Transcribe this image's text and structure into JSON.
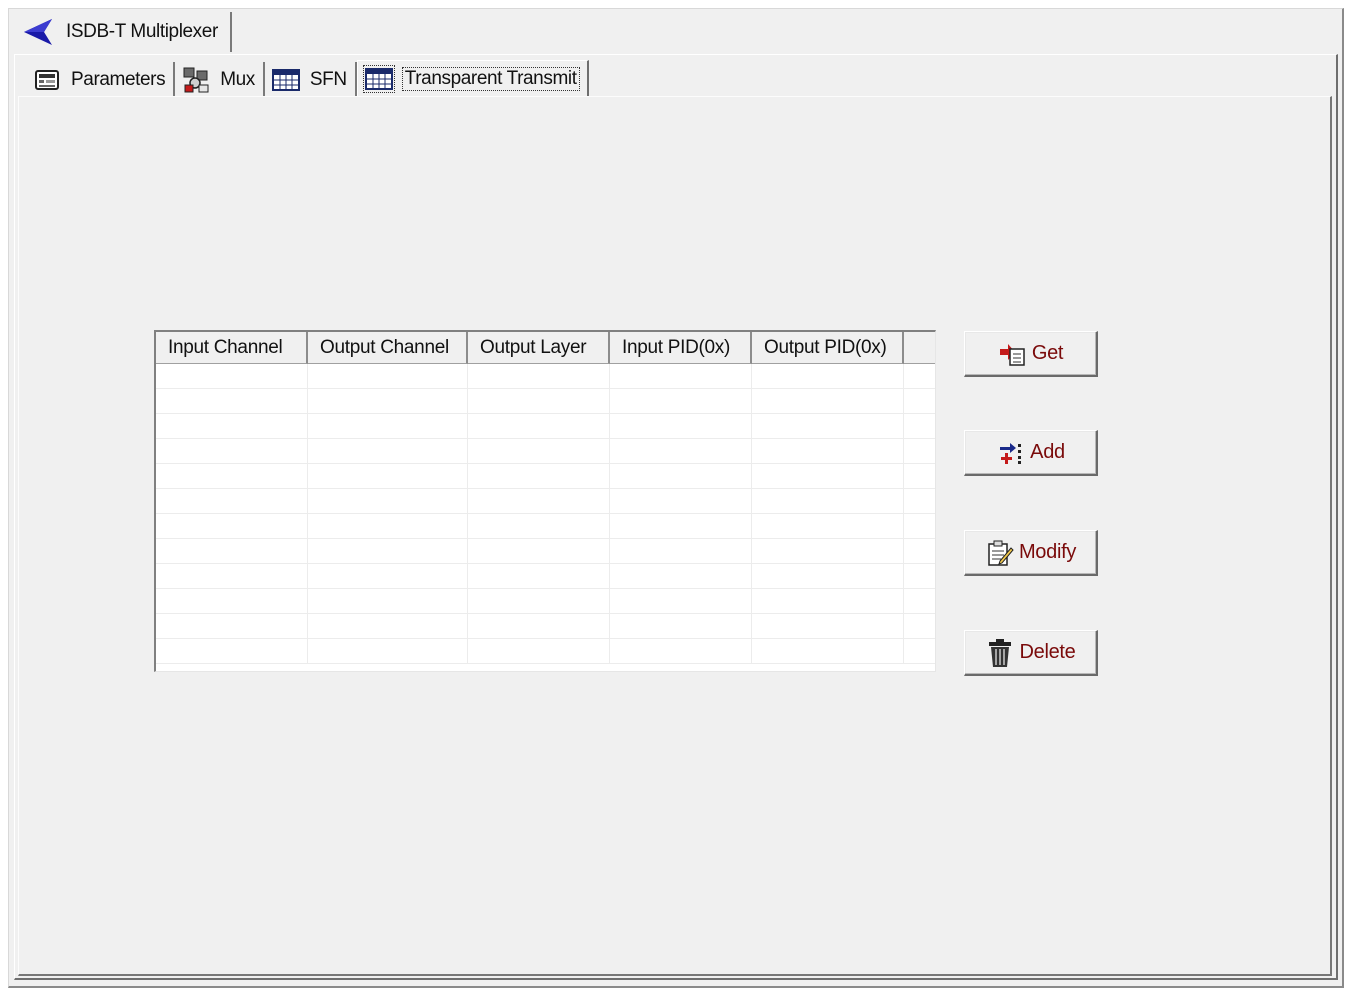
{
  "window": {
    "title_tab": "ISDB-T Multiplexer",
    "back_icon": "back-arrow-icon",
    "accent_color": "#1a1aa8"
  },
  "tabs": [
    {
      "label": "Parameters",
      "icon": "parameters-icon",
      "active": false
    },
    {
      "label": "Mux",
      "icon": "mux-icon",
      "active": false
    },
    {
      "label": "SFN",
      "icon": "table-icon",
      "active": false
    },
    {
      "label": "Transparent Transmit",
      "icon": "table-icon",
      "active": true
    }
  ],
  "table": {
    "columns": [
      "Input Channel",
      "Output Channel",
      "Output Layer",
      "Input PID(0x)",
      "Output PID(0x)"
    ],
    "rows": []
  },
  "actions": {
    "get_label": "Get",
    "add_label": "Add",
    "modify_label": "Modify",
    "delete_label": "Delete",
    "button_text_color": "#7a0a0a"
  }
}
